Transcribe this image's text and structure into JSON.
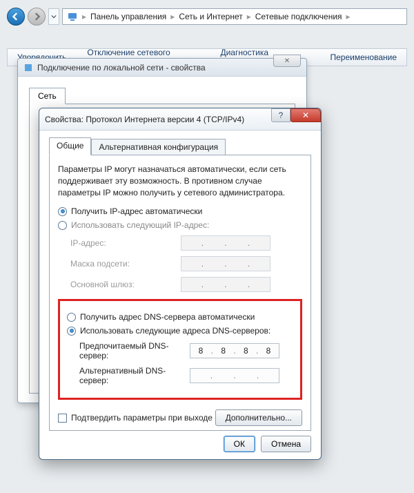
{
  "nav": {
    "breadcrumb": [
      "Панель управления",
      "Сеть и Интернет",
      "Сетевые подключения"
    ]
  },
  "toolbar": {
    "item1": "Упорядочить",
    "item2": "Отключение сетевого устройства",
    "item3": "Диагностика подключения",
    "item4": "Переименование"
  },
  "win1": {
    "title": "Подключение по локальной сети - свойства",
    "tab": "Сеть"
  },
  "win2": {
    "title": "Свойства: Протокол Интернета версии 4 (TCP/IPv4)",
    "tabs": {
      "general": "Общие",
      "alt": "Альтернативная конфигурация"
    },
    "desc": "Параметры IP могут назначаться автоматически, если сеть поддерживает эту возможность. В противном случае параметры IP можно получить у сетевого администратора.",
    "ip": {
      "auto": "Получить IP-адрес автоматически",
      "manual": "Использовать следующий IP-адрес:",
      "addr": "IP-адрес:",
      "mask": "Маска подсети:",
      "gw": "Основной шлюз:"
    },
    "dns": {
      "auto": "Получить адрес DNS-сервера автоматически",
      "manual": "Использовать следующие адреса DNS-серверов:",
      "pref": "Предпочитаемый DNS-сервер:",
      "alt": "Альтернативный DNS-сервер:",
      "pref_value": [
        "8",
        "8",
        "8",
        "8"
      ],
      "alt_value": [
        "",
        "",
        "",
        ""
      ]
    },
    "confirm": "Подтвердить параметры при выходе",
    "advanced": "Дополнительно...",
    "ok": "ОК",
    "cancel": "Отмена"
  }
}
